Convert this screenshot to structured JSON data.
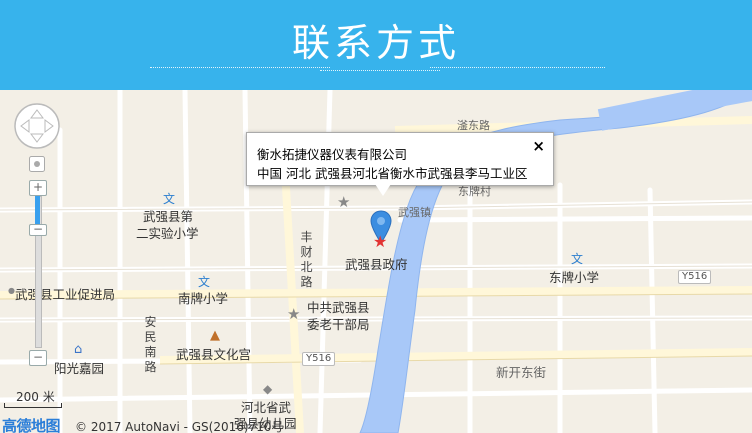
{
  "header": {
    "title": "联系方式"
  },
  "popup": {
    "company": "衡水拓捷仪器仪表有限公司",
    "address": "中国 河北 武强县河北省衡水市武强县李马工业区",
    "close_label": "×"
  },
  "map_labels": {
    "road_top": "滏东路",
    "wuqiang_town": "武强镇",
    "dongpai_village": "东牌村",
    "school2": "武强县第\n二实验小学",
    "school2_line1": "武强县第",
    "school2_line2": "二实验小学",
    "gov": "武强县政府",
    "dongpai_school": "东牌小学",
    "industry": "武强县工业促进局",
    "nanpai_school": "南牌小学",
    "party_line1": "中共武强县",
    "party_line2": "委老干部局",
    "culture": "武强县文化宫",
    "yangguang": "阳光嘉园",
    "xinkai": "新开东街",
    "fengcai_road": "丰财北路",
    "anmin_road": "安民南路",
    "y516_a": "Y516",
    "y516_b": "Y516",
    "hebei_line1": "河北省武",
    "hebei_line2": "强县幼儿园"
  },
  "controls": {
    "zoom_in": "+",
    "zoom_out": "−",
    "scale": "200 米"
  },
  "footer": {
    "logo": "高德地图",
    "copyright": "© 2017 AutoNavi - GS(2016)710号"
  },
  "icons": {
    "pan": "pan-control-icon",
    "locate": "locate-icon",
    "marker": "location-marker-icon",
    "star": "star-icon",
    "school": "school-icon",
    "building": "building-icon",
    "home": "home-icon"
  },
  "colors": {
    "header_bg": "#37b3ec",
    "river": "#a8c8f8",
    "map_bg": "#f3efe6",
    "marker": "#3b8de0",
    "star": "#e23434"
  }
}
